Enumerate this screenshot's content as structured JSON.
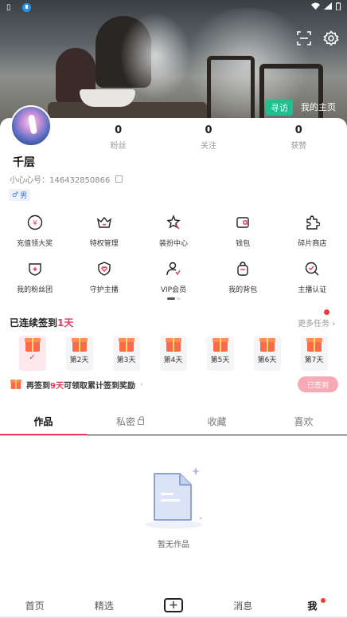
{
  "status_bar": {
    "right": "◆◢▮"
  },
  "header": {
    "visit_label": "寻访",
    "home_label": "我的主页"
  },
  "profile": {
    "name": "千层",
    "uid": "小心心号：146432850866",
    "gender": "男",
    "stats": [
      {
        "num": "0",
        "label": "粉丝"
      },
      {
        "num": "0",
        "label": "关注"
      },
      {
        "num": "0",
        "label": "获赞"
      }
    ]
  },
  "features": [
    [
      {
        "label": "充值领大奖",
        "icon": "yen-icon"
      },
      {
        "label": "特权管理",
        "icon": "crown-icon"
      },
      {
        "label": "装扮中心",
        "icon": "magic-wand-icon"
      },
      {
        "label": "钱包",
        "icon": "wallet-icon"
      },
      {
        "label": "碎片商店",
        "icon": "puzzle-icon"
      }
    ],
    [
      {
        "label": "我的粉丝团",
        "icon": "fan-club-icon"
      },
      {
        "label": "守护主播",
        "icon": "shield-heart-icon"
      },
      {
        "label": "VIP会员",
        "icon": "vip-user-icon"
      },
      {
        "label": "我的背包",
        "icon": "backpack-icon"
      },
      {
        "label": "主播认证",
        "icon": "verify-icon"
      }
    ]
  ],
  "checkin": {
    "title_prefix": "已连续签到",
    "title_days": "1天",
    "more_tasks": "更多任务",
    "days": [
      {
        "label": "",
        "done": true
      },
      {
        "label": "第2天"
      },
      {
        "label": "第3天"
      },
      {
        "label": "第4天"
      },
      {
        "label": "第5天"
      },
      {
        "label": "第6天"
      },
      {
        "label": "第7天"
      }
    ],
    "reward_prefix": "再签到",
    "reward_days": "9天",
    "reward_suffix": "可领取累计签到奖励",
    "signed_label": "已签到"
  },
  "tabs": [
    {
      "label": "作品",
      "active": true
    },
    {
      "label": "私密"
    },
    {
      "label": "收藏"
    },
    {
      "label": "喜欢"
    }
  ],
  "empty": {
    "text": "暂无作品"
  },
  "bottom_nav": {
    "items": [
      "首页",
      "精选",
      "+",
      "消息",
      "我"
    ]
  },
  "colors": {
    "accent": "#e8365d",
    "visit_green": "#1fbf8f"
  }
}
